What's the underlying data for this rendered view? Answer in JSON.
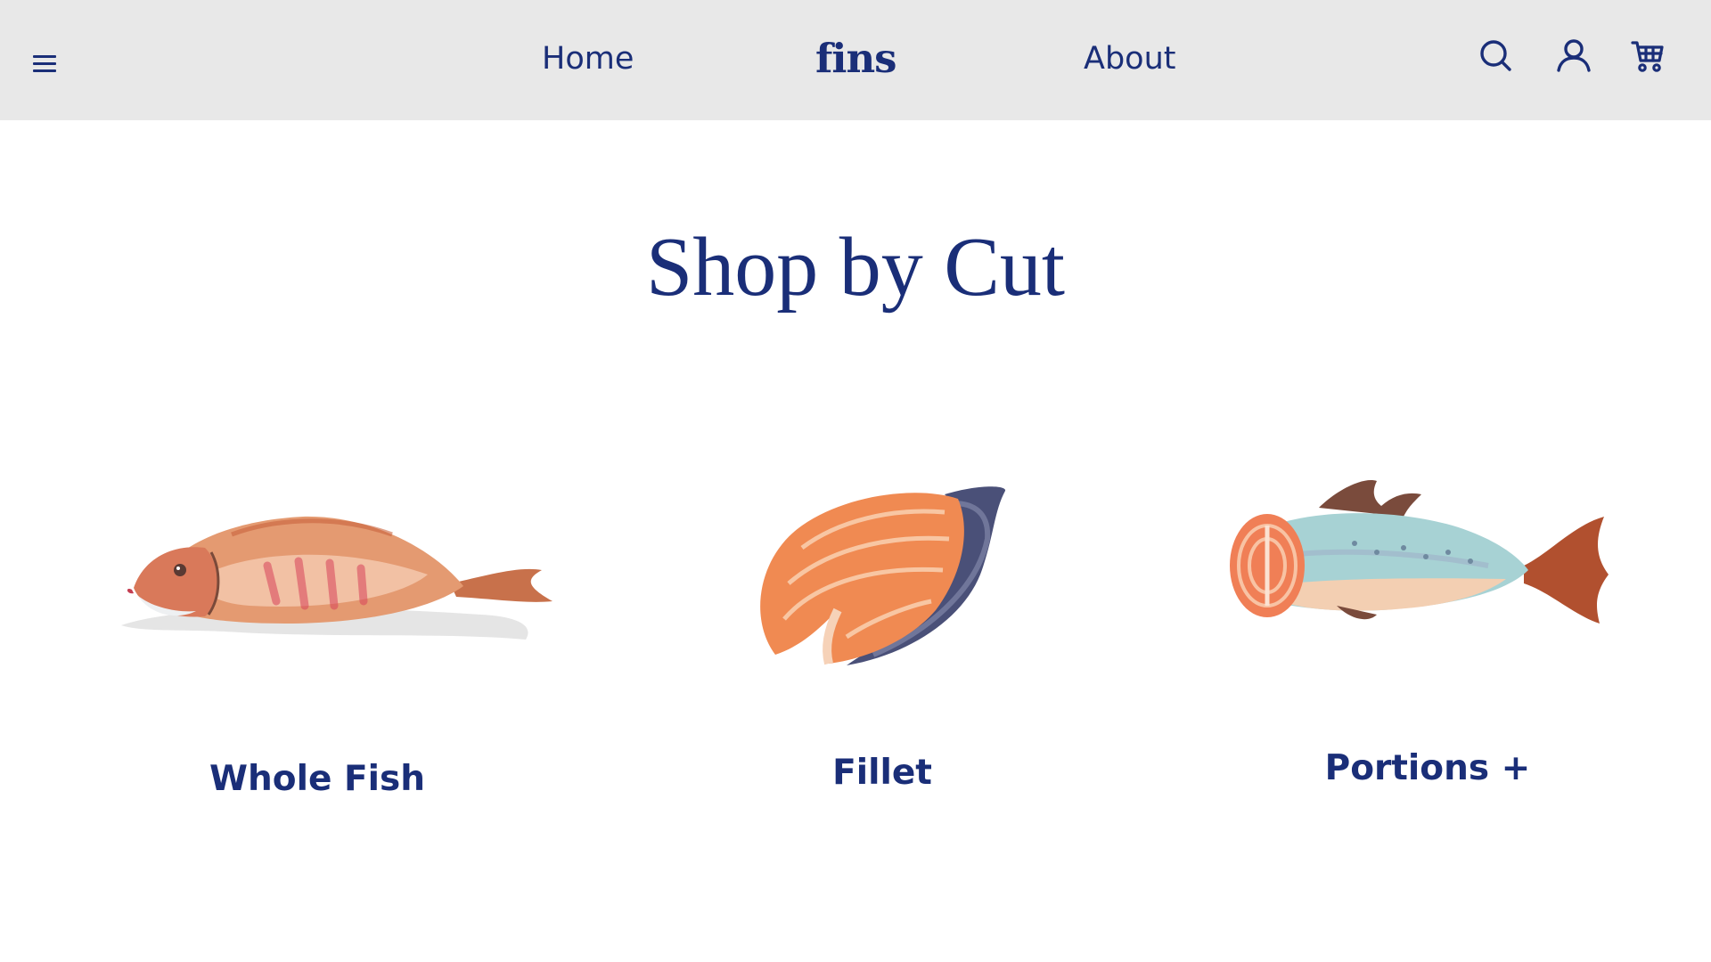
{
  "header": {
    "menu_icon": "hamburger-menu-icon",
    "nav": {
      "home_label": "Home",
      "about_label": "About"
    },
    "logo_text": "fins",
    "icons": {
      "search": "search-icon",
      "account": "user-icon",
      "cart": "cart-icon"
    },
    "background_color": "#e8e8e8",
    "text_color": "#1a2e78"
  },
  "main": {
    "title": "Shop by Cut",
    "cuts": [
      {
        "label": "Whole Fish",
        "image": "whole-fish-watercolor"
      },
      {
        "label": "Fillet",
        "image": "salmon-fillet-steak-watercolor"
      },
      {
        "label": "Portions +",
        "image": "cut-fish-portion-watercolor"
      }
    ]
  }
}
